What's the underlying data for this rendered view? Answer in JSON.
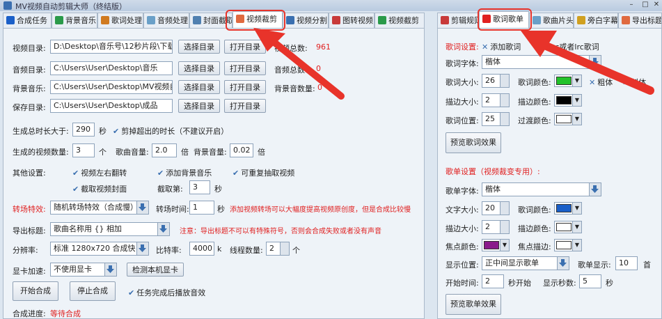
{
  "window": {
    "title": "MV视频自动剪辑大师（终结版）"
  },
  "left_tabs": [
    "合成任务",
    "背景音乐",
    "歌词处理",
    "音频处理",
    "封面截取",
    "视频裁剪",
    "视频分割",
    "图转视频",
    "视频截剪"
  ],
  "right_tabs": [
    "剪辑规则",
    "歌词歌单",
    "歌曲片头",
    "旁白字幕",
    "导出标题"
  ],
  "dirs": {
    "video_label": "视频目录:",
    "video_value": "D:\\Desktop\\音乐号\\12秒片段\\下载",
    "audio_label": "音频目录:",
    "audio_value": "C:\\Users\\User\\Desktop\\音乐",
    "bgm_label": "背景音乐:",
    "bgm_value": "C:\\Users\\User\\Desktop\\MV视频自动",
    "save_label": "保存目录:",
    "save_value": "C:\\Users\\User\\Desktop\\成品",
    "select_btn": "选择目录",
    "open_btn": "打开目录",
    "video_count_label": "视频总数:",
    "video_count": "961",
    "audio_count_label": "音频总数:",
    "audio_count": "0",
    "bgm_count_label": "背景音数量:",
    "bgm_count": "0"
  },
  "params": {
    "duration_label": "生成总时长大于:",
    "duration_value": "290",
    "duration_unit": "秒",
    "trim_label": "剪掉超出的时长（不建议开启）",
    "count_label": "生成的视频数量:",
    "count_value": "3",
    "count_unit": "个",
    "song_vol_label": "歌曲音量:",
    "song_vol_value": "2.0",
    "song_vol_unit": "倍",
    "bgm_vol_label": "背景音量:",
    "bgm_vol_value": "0.02",
    "bgm_vol_unit": "倍",
    "other_label": "其他设置:",
    "opt1": "视频左右翻转",
    "opt2": "添加背景音乐",
    "opt3": "可重复抽取视频",
    "opt4": "截取视频封面",
    "screenshot_label": "截取第:",
    "screenshot_value": "3",
    "screenshot_unit": "秒",
    "trans_label": "转场特效:",
    "trans_value": "随机转场特效（合成慢）",
    "trans_time_label": "转场时间:",
    "trans_time_value": "1",
    "trans_time_unit": "秒",
    "trans_note": "添加视频转场可以大幅度提高视频原创度，但是合成比较慢",
    "title_label": "导出标题:",
    "title_value": "歌曲名称用 {} 相加",
    "title_note": "注意：导出标题不可以有特殊符号，否则会合成失败或者没有声音",
    "res_label": "分辨率:",
    "res_value": "标准 1280x720 合成快",
    "bitrate_label": "比特率:",
    "bitrate_value": "4000",
    "bitrate_unit": "k",
    "threads_label": "线程数量:",
    "threads_value": "2",
    "threads_unit": "个",
    "gpu_label": "显卡加速:",
    "gpu_value": "不使用显卡",
    "gpu_detect_btn": "检测本机显卡",
    "start_btn": "开始合成",
    "stop_btn": "停止合成",
    "sound_label": "任务完成后播放音效",
    "progress_label": "合成进度:",
    "progress_value": "等待合成"
  },
  "lyrics": {
    "section_label": "歌词设置:",
    "add_lyrics": "添加歌词",
    "lrc_note": "lrc或者lrc歌词",
    "font_label": "歌词字体:",
    "font_value": "楷体",
    "size_label": "歌词大小:",
    "size_value": "26",
    "color_label": "歌词颜色:",
    "bold_label": "粗体",
    "italic_label": "斜体",
    "stroke_label": "描边大小:",
    "stroke_value": "2",
    "stroke_color_label": "描边颜色:",
    "pos_label": "歌词位置:",
    "pos_value": "25",
    "fade_label": "过渡颜色:",
    "preview_btn": "预览歌词效果",
    "colors": {
      "lyrics": "#22c22a",
      "stroke": "#000000",
      "fade": "#ffffff"
    }
  },
  "playlist": {
    "section_label": "歌单设置（视频裁变专用）:",
    "font_label": "歌单字体:",
    "font_value": "楷体",
    "size_label": "文字大小:",
    "size_value": "20",
    "color_label": "歌词颜色:",
    "stroke_label": "描边大小:",
    "stroke_value": "2",
    "stroke_color_label": "描边颜色:",
    "focus_label": "焦点颜色:",
    "focus_stroke_label": "焦点描边:",
    "display_label": "显示位置:",
    "display_value": "正中间显示歌单",
    "show_label": "歌单显示:",
    "show_value": "10",
    "show_unit": "首",
    "start_label": "开始时间:",
    "start_value": "2",
    "start_unit": "秒开始",
    "secs_label": "显示秒数:",
    "secs_value": "5",
    "secs_unit": "秒",
    "preview_btn": "预览歌单效果",
    "colors": {
      "text": "#1a5fc8",
      "stroke": "#ffffff",
      "focus": "#8a1a8a",
      "focus_stroke": "#ffffff"
    }
  }
}
